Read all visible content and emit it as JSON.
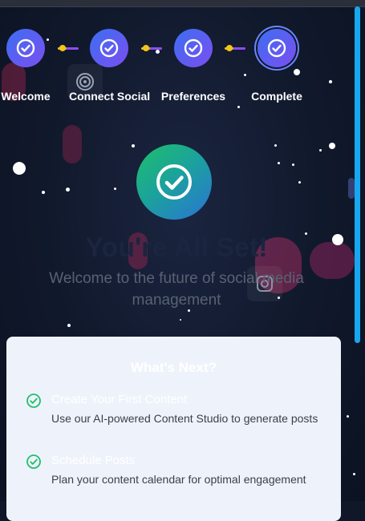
{
  "steps": [
    {
      "label": "Welcome",
      "active": false
    },
    {
      "label": "Connect Social",
      "active": false
    },
    {
      "label": "Preferences",
      "active": false
    },
    {
      "label": "Complete",
      "active": true
    }
  ],
  "hero": {
    "title": "You're All Set!",
    "subtitle": "Welcome to the future of social media management"
  },
  "next": {
    "heading": "What's Next?",
    "items": [
      {
        "title": "Create Your First Content",
        "description": "Use our AI-powered Content Studio to generate posts"
      },
      {
        "title": "Schedule Posts",
        "description": "Plan your content calendar for optimal engagement"
      }
    ]
  },
  "colors": {
    "accent": "#3b6ff2",
    "accent2": "#7c4ef0",
    "success": "#1fbf6a",
    "scrollbar": "#17a7f0"
  },
  "icons": [
    "check-circle-icon",
    "check-icon",
    "target-icon",
    "instagram-icon"
  ]
}
